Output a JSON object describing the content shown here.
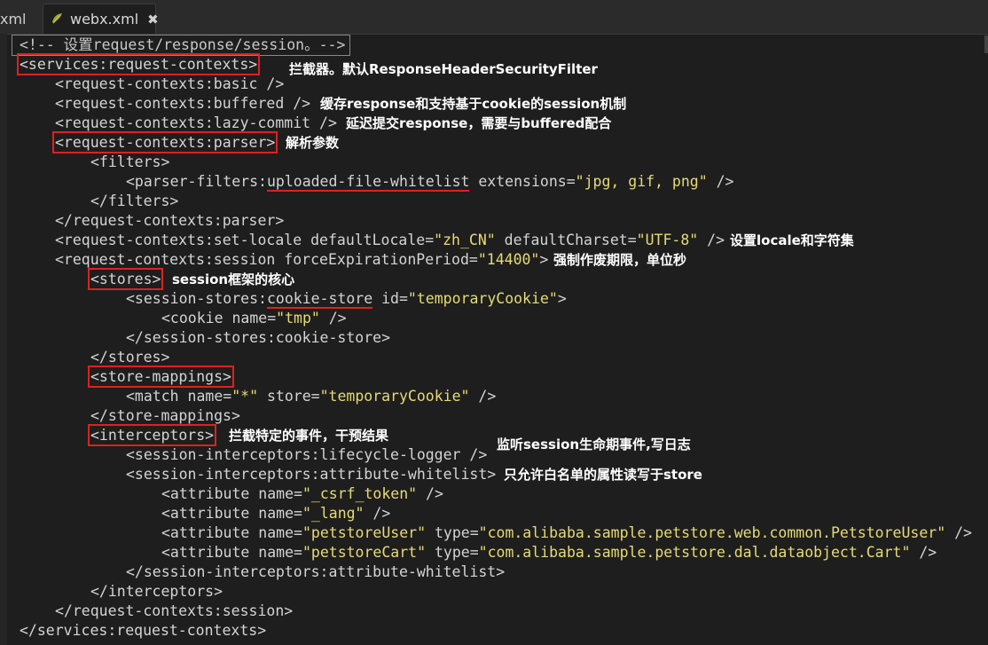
{
  "tabs": [
    {
      "label": "xml",
      "active": false
    },
    {
      "label": "webx.xml",
      "active": true,
      "icon": "xml-file-icon"
    }
  ],
  "code_lines": [
    {
      "indent": 0,
      "parts": [
        {
          "t": "c",
          "s": "<!-- 设置request/response/session。-->"
        }
      ]
    },
    {
      "indent": 0,
      "parts": [
        {
          "t": "t",
          "s": "<services:request-contexts>",
          "box": true
        }
      ]
    },
    {
      "indent": 1,
      "parts": [
        {
          "t": "t",
          "s": "<request-contexts:basic />"
        }
      ]
    },
    {
      "indent": 1,
      "parts": [
        {
          "t": "t",
          "s": "<request-contexts:buffered />"
        }
      ]
    },
    {
      "indent": 1,
      "parts": [
        {
          "t": "t",
          "s": "<request-contexts:lazy-commit />"
        }
      ]
    },
    {
      "indent": 1,
      "parts": [
        {
          "t": "t",
          "s": "<request-contexts:parser>",
          "box": true
        }
      ]
    },
    {
      "indent": 2,
      "parts": [
        {
          "t": "t",
          "s": "<filters>"
        }
      ]
    },
    {
      "indent": 3,
      "parts": [
        {
          "t": "t",
          "s": "<parser-filters:"
        },
        {
          "t": "t",
          "s": "uploaded-file-whitelist",
          "ul": true
        },
        {
          "t": "t",
          "s": " extensions="
        },
        {
          "t": "v",
          "s": "\"jpg, gif, png\""
        },
        {
          "t": "t",
          "s": " />"
        }
      ]
    },
    {
      "indent": 2,
      "parts": [
        {
          "t": "t",
          "s": "</filters>"
        }
      ]
    },
    {
      "indent": 1,
      "parts": [
        {
          "t": "t",
          "s": "</request-contexts:parser>"
        }
      ]
    },
    {
      "indent": 1,
      "parts": [
        {
          "t": "t",
          "s": "<request-contexts:set-locale defaultLocale="
        },
        {
          "t": "v",
          "s": "\"zh_CN\""
        },
        {
          "t": "t",
          "s": " defaultCharset="
        },
        {
          "t": "v",
          "s": "\"UTF-8\""
        },
        {
          "t": "t",
          "s": " />"
        }
      ]
    },
    {
      "indent": 1,
      "parts": [
        {
          "t": "t",
          "s": "<request-contexts:session forceExpirationPeriod="
        },
        {
          "t": "v",
          "s": "\"14400\""
        },
        {
          "t": "t",
          "s": ">"
        }
      ]
    },
    {
      "indent": 2,
      "parts": [
        {
          "t": "t",
          "s": "<stores>",
          "box": true
        }
      ]
    },
    {
      "indent": 3,
      "parts": [
        {
          "t": "t",
          "s": "<session-stores:"
        },
        {
          "t": "t",
          "s": "cookie-store",
          "ul": true
        },
        {
          "t": "t",
          "s": " id="
        },
        {
          "t": "v",
          "s": "\"temporaryCookie\""
        },
        {
          "t": "t",
          "s": ">"
        }
      ]
    },
    {
      "indent": 4,
      "parts": [
        {
          "t": "t",
          "s": "<cookie name="
        },
        {
          "t": "v",
          "s": "\"tmp\""
        },
        {
          "t": "t",
          "s": " />"
        }
      ]
    },
    {
      "indent": 3,
      "parts": [
        {
          "t": "t",
          "s": "</session-stores:cookie-store>"
        }
      ]
    },
    {
      "indent": 2,
      "parts": [
        {
          "t": "t",
          "s": "</stores>"
        }
      ]
    },
    {
      "indent": 2,
      "parts": [
        {
          "t": "t",
          "s": "<store-mappings>",
          "box": true
        }
      ]
    },
    {
      "indent": 3,
      "parts": [
        {
          "t": "t",
          "s": "<match name="
        },
        {
          "t": "v",
          "s": "\"*\""
        },
        {
          "t": "t",
          "s": " store="
        },
        {
          "t": "v",
          "s": "\"temporaryCookie\""
        },
        {
          "t": "t",
          "s": " />"
        }
      ]
    },
    {
      "indent": 2,
      "parts": [
        {
          "t": "t",
          "s": "</store-mappings>"
        }
      ]
    },
    {
      "indent": 2,
      "parts": [
        {
          "t": "t",
          "s": "<interceptors>",
          "box": true
        }
      ]
    },
    {
      "indent": 3,
      "parts": [
        {
          "t": "t",
          "s": "<session-interceptors:lifecycle-logger />"
        }
      ]
    },
    {
      "indent": 3,
      "parts": [
        {
          "t": "t",
          "s": "<session-interceptors:attribute-whitelist>"
        }
      ]
    },
    {
      "indent": 4,
      "parts": [
        {
          "t": "t",
          "s": "<attribute name="
        },
        {
          "t": "v",
          "s": "\"_csrf_token\""
        },
        {
          "t": "t",
          "s": " />"
        }
      ]
    },
    {
      "indent": 4,
      "parts": [
        {
          "t": "t",
          "s": "<attribute name="
        },
        {
          "t": "v",
          "s": "\"_lang\""
        },
        {
          "t": "t",
          "s": " />"
        }
      ]
    },
    {
      "indent": 4,
      "parts": [
        {
          "t": "t",
          "s": "<attribute name="
        },
        {
          "t": "v",
          "s": "\"petstoreUser\""
        },
        {
          "t": "t",
          "s": " type="
        },
        {
          "t": "v",
          "s": "\"com.alibaba.sample.petstore.web.common.PetstoreUser\""
        },
        {
          "t": "t",
          "s": " />"
        }
      ]
    },
    {
      "indent": 4,
      "parts": [
        {
          "t": "t",
          "s": "<attribute name="
        },
        {
          "t": "v",
          "s": "\"petstoreCart\""
        },
        {
          "t": "t",
          "s": " type="
        },
        {
          "t": "v",
          "s": "\"com.alibaba.sample.petstore.dal.dataobject.Cart\""
        },
        {
          "t": "t",
          "s": " />"
        }
      ]
    },
    {
      "indent": 3,
      "parts": [
        {
          "t": "t",
          "s": "</session-interceptors:attribute-whitelist>"
        }
      ]
    },
    {
      "indent": 2,
      "parts": [
        {
          "t": "t",
          "s": "</interceptors>"
        }
      ]
    },
    {
      "indent": 1,
      "parts": [
        {
          "t": "t",
          "s": "</request-contexts:session>"
        }
      ]
    },
    {
      "indent": 0,
      "parts": [
        {
          "t": "t",
          "s": "</services:request-contexts>"
        }
      ]
    }
  ],
  "annotations": [
    {
      "line": 1,
      "text": "拦截器。默认ResponseHeaderSecurityFilter"
    },
    {
      "line": 3,
      "text": "缓存response和支持基于cookie的session机制"
    },
    {
      "line": 4,
      "text": "延迟提交response，需要与buffered配合"
    },
    {
      "line": 5,
      "text": "解析参数"
    },
    {
      "line": 10,
      "text": "设置locale和字符集"
    },
    {
      "line": 11,
      "text": "强制作废期限，单位秒"
    },
    {
      "line": 12,
      "text": "session框架的核心"
    },
    {
      "line": 20,
      "text": "拦截特定的事件，干预结果"
    },
    {
      "line": 21,
      "text": "监听session生命期事件,写日志"
    },
    {
      "line": 22,
      "text": "只允许白名单的属性读写于store"
    }
  ]
}
